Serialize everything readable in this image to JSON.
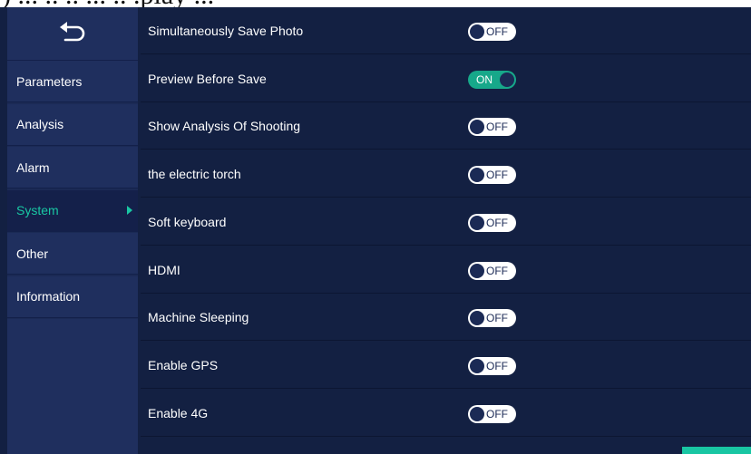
{
  "header": {
    "cut_text": ") ... ..  .. ... .. .play ..."
  },
  "sidebar": {
    "back_icon": "undo-arrow-icon",
    "items": [
      {
        "label": "Parameters",
        "active": false
      },
      {
        "label": "Analysis",
        "active": false
      },
      {
        "label": "Alarm",
        "active": false
      },
      {
        "label": "System",
        "active": true
      },
      {
        "label": "Other",
        "active": false
      },
      {
        "label": "Information",
        "active": false
      }
    ]
  },
  "settings": [
    {
      "label": "Simultaneously Save Photo",
      "state": "OFF"
    },
    {
      "label": "Preview Before Save",
      "state": "ON"
    },
    {
      "label": "Show Analysis Of Shooting",
      "state": "OFF"
    },
    {
      "label": "the electric torch",
      "state": "OFF"
    },
    {
      "label": "Soft keyboard",
      "state": "OFF"
    },
    {
      "label": "HDMI",
      "state": "OFF"
    },
    {
      "label": "Machine Sleeping",
      "state": "OFF"
    },
    {
      "label": "Enable GPS",
      "state": "OFF"
    },
    {
      "label": "Enable 4G",
      "state": "OFF"
    }
  ],
  "colors": {
    "background": "#132042",
    "sidebar": "#1f2f5e",
    "accent": "#19c6a3",
    "toggle_on": "#17a88a"
  }
}
